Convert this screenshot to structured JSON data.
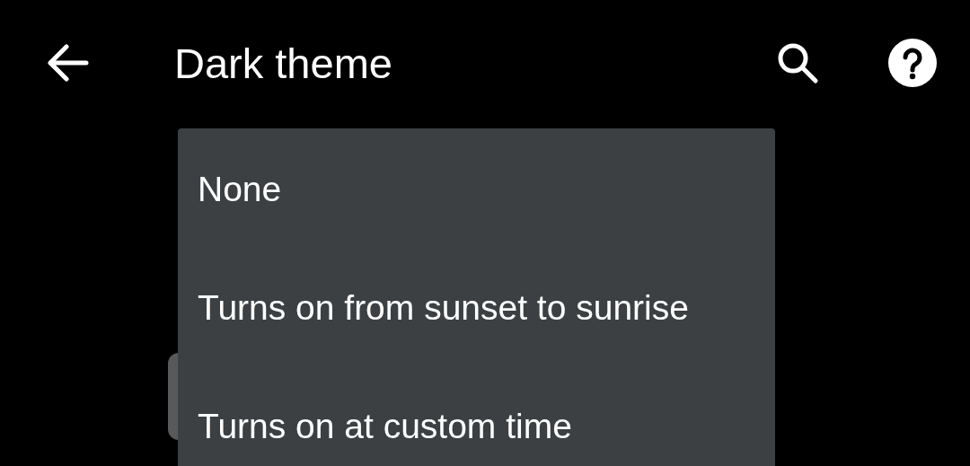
{
  "app_bar": {
    "title": "Dark theme"
  },
  "menu": {
    "items": [
      {
        "label": "None"
      },
      {
        "label": "Turns on from sunset to sunrise"
      },
      {
        "label": "Turns on at custom time"
      }
    ]
  }
}
